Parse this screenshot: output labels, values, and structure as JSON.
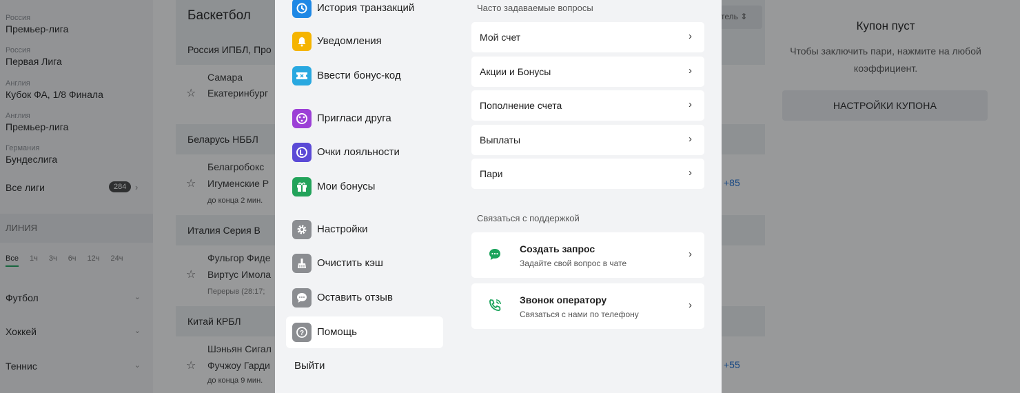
{
  "background": {
    "leagues": [
      {
        "country": "Россия",
        "name": "Премьер-лига"
      },
      {
        "country": "Россия",
        "name": "Первая Лига"
      },
      {
        "country": "Англия",
        "name": "Кубок ФА, 1/8 Финала"
      },
      {
        "country": "Англия",
        "name": "Премьер-лига"
      },
      {
        "country": "Германия",
        "name": "Бундеслига"
      }
    ],
    "all_leagues_label": "Все лиги",
    "all_leagues_count": "284",
    "line_label": "ЛИНИЯ",
    "time_filters": [
      "Все",
      "1ч",
      "3ч",
      "6ч",
      "12ч",
      "24ч"
    ],
    "sports": [
      "Футбол",
      "Хоккей",
      "Теннис"
    ],
    "mid_title": "Баскетбол",
    "sort_label": "тель",
    "league_headers": [
      "Россия ИПБЛ, Про",
      "Беларусь НББЛ",
      "Италия Серия B",
      "Китай КРБЛ"
    ],
    "matches": [
      {
        "team1": "Самара",
        "team2": "Екатеринбург",
        "meta": "",
        "more": ""
      },
      {
        "team1": "Белагробокс",
        "team2": "Игуменские Р",
        "meta": "до конца 2 мин.",
        "more": "+85"
      },
      {
        "team1": "Фульгор Фиде",
        "team2": "Виртус Имола",
        "meta": "Перерыв (28:17;",
        "more": ""
      },
      {
        "team1": "Шэньян Сигал",
        "team2": "Фучжоу Гарди",
        "meta": "до конца 9 мин.",
        "more": "+55"
      }
    ],
    "coupon": {
      "title": "Купон пуст",
      "text": "Чтобы заключить пари, нажмите на любой коэффициент.",
      "settings_button": "НАСТРОЙКИ КУПОНА"
    }
  },
  "menu": {
    "items": [
      {
        "label": "История транзакций",
        "icon": "history-icon",
        "color": "#1e88e5"
      },
      {
        "label": "Уведомления",
        "icon": "bell-icon",
        "color": "#f5b400"
      },
      {
        "label": "Ввести бонус-код",
        "icon": "ticket-icon",
        "color": "#29a8e0"
      },
      {
        "label": "Пригласи друга",
        "icon": "invite-icon",
        "color": "#9c3fd6"
      },
      {
        "label": "Очки лояльности",
        "icon": "loyalty-icon",
        "color": "#5b4ad6"
      },
      {
        "label": "Мои бонусы",
        "icon": "gift-icon",
        "color": "#22a35a"
      },
      {
        "label": "Настройки",
        "icon": "gear-icon",
        "color": "#8b8d91"
      },
      {
        "label": "Очистить кэш",
        "icon": "broom-icon",
        "color": "#8b8d91"
      },
      {
        "label": "Оставить отзыв",
        "icon": "chat-icon",
        "color": "#8b8d91"
      },
      {
        "label": "Помощь",
        "icon": "help-icon",
        "color": "#8b8d91"
      }
    ],
    "logout": "Выйти"
  },
  "faq": {
    "title": "Часто задаваемые вопросы",
    "items": [
      "Мой счет",
      "Акции и Бонусы",
      "Пополнение счета",
      "Выплаты",
      "Пари"
    ]
  },
  "support": {
    "title": "Связаться с поддержкой",
    "items": [
      {
        "title": "Создать запрос",
        "subtitle": "Задайте свой вопрос в чате",
        "icon": "chat-bubble-icon"
      },
      {
        "title": "Звонок оператору",
        "subtitle": "Связаться с нами по телефону",
        "icon": "phone-icon"
      }
    ]
  },
  "colors": {
    "accent": "#1aa35b",
    "overlay": "rgba(20,22,26,0.44)"
  }
}
